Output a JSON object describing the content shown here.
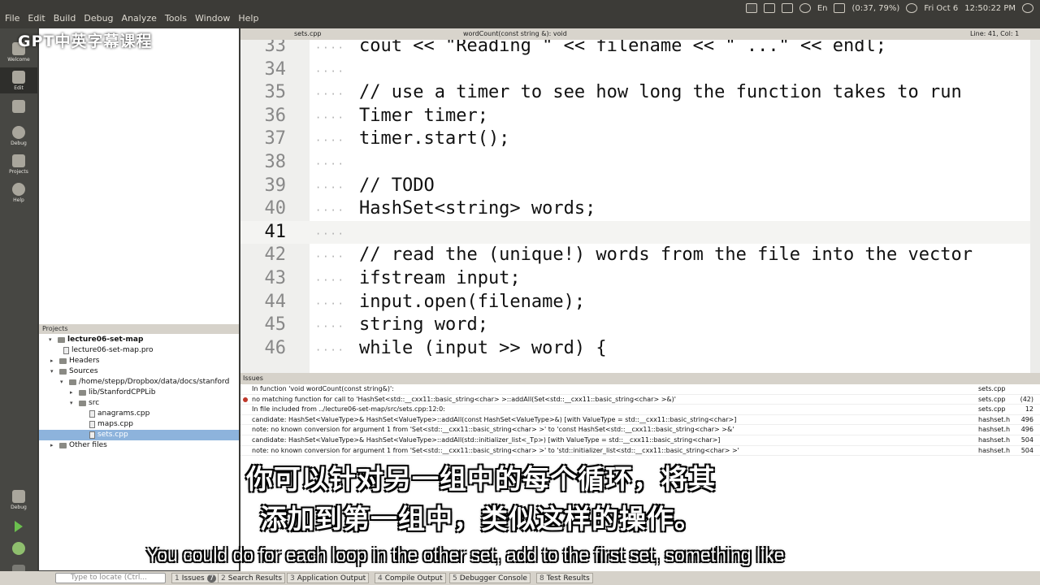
{
  "watermark": "GPT中英字幕课程",
  "menubar": {
    "items": [
      "File",
      "Edit",
      "Build",
      "Debug",
      "Analyze",
      "Tools",
      "Window",
      "Help"
    ],
    "tray": {
      "input_method": "En",
      "battery": "(0:37, 79%)",
      "datetime": "Fri Oct 6",
      "clock": "12:50:22 PM"
    }
  },
  "modebar": {
    "items": [
      {
        "label": "Welcome",
        "icon": "welcome-icon"
      },
      {
        "label": "Edit",
        "icon": "edit-icon"
      },
      {
        "label": "Design",
        "icon": "design-icon"
      },
      {
        "label": "Debug",
        "icon": "debug-icon"
      },
      {
        "label": "Projects",
        "icon": "projects-icon"
      },
      {
        "label": "Help",
        "icon": "help-icon"
      },
      {
        "label": "Debug",
        "icon": "debug-run-icon"
      }
    ]
  },
  "editor": {
    "file_tab": "sets.cpp",
    "function_combo": "wordCount(const string &): void",
    "position": "Line: 41, Col: 1",
    "lines": [
      {
        "num": "33",
        "code": "cout << \"Reading \" << filename << \" ...\" << endl;"
      },
      {
        "num": "34",
        "code": ""
      },
      {
        "num": "35",
        "code": "// use a timer to see how long the function takes to run"
      },
      {
        "num": "36",
        "code": "Timer timer;"
      },
      {
        "num": "37",
        "code": "timer.start();"
      },
      {
        "num": "38",
        "code": ""
      },
      {
        "num": "39",
        "code": "// TODO"
      },
      {
        "num": "40",
        "code": "HashSet<string> words;"
      },
      {
        "num": "41",
        "code": ""
      },
      {
        "num": "42",
        "code": "// read the (unique!) words from the file into the vector"
      },
      {
        "num": "43",
        "code": "ifstream input;"
      },
      {
        "num": "44",
        "code": "input.open(filename);"
      },
      {
        "num": "45",
        "code": "string word;"
      },
      {
        "num": "46",
        "code": "while (input >> word) {"
      }
    ]
  },
  "projects": {
    "header": "Projects",
    "tree": [
      {
        "label": "lecture06-set-map",
        "type": "project"
      },
      {
        "label": "lecture06-set-map.pro",
        "type": "file"
      },
      {
        "label": "Headers",
        "type": "folder"
      },
      {
        "label": "Sources",
        "type": "folder"
      },
      {
        "label": "/home/stepp/Dropbox/data/docs/stanford",
        "type": "folder"
      },
      {
        "label": "lib/StanfordCPPLib",
        "type": "folder"
      },
      {
        "label": "src",
        "type": "folder"
      },
      {
        "label": "anagrams.cpp",
        "type": "file"
      },
      {
        "label": "maps.cpp",
        "type": "file"
      },
      {
        "label": "sets.cpp",
        "type": "file"
      },
      {
        "label": "Other files",
        "type": "folder"
      }
    ]
  },
  "issues": {
    "header": "Issues",
    "rows": [
      {
        "msg": "In function 'void wordCount(const string&)':",
        "file": "sets.cpp",
        "line": ""
      },
      {
        "msg": "no matching function for call to 'HashSet<std::__cxx11::basic_string<char> >::addAll(Set<std::__cxx11::basic_string<char> >&)'",
        "file": "sets.cpp",
        "line": "(42)"
      },
      {
        "msg": "In file included from ../lecture06-set-map/src/sets.cpp:12:0:",
        "file": "sets.cpp",
        "line": "12"
      },
      {
        "msg": "candidate: HashSet<ValueType>& HashSet<ValueType>::addAll(const HashSet<ValueType>&) [with ValueType = std::__cxx11::basic_string<char>]",
        "file": "hashset.h",
        "line": "496"
      },
      {
        "msg": "note:   no known conversion for argument 1 from 'Set<std::__cxx11::basic_string<char> >' to 'const HashSet<std::__cxx11::basic_string<char> >&'",
        "file": "hashset.h",
        "line": "496"
      },
      {
        "msg": "candidate: HashSet<ValueType>& HashSet<ValueType>::addAll(std::initializer_list<_Tp>) [with ValueType = std::__cxx11::basic_string<char>]",
        "file": "hashset.h",
        "line": "504"
      },
      {
        "msg": "note:   no known conversion for argument 1 from 'Set<std::__cxx11::basic_string<char> >' to 'std::initializer_list<std::__cxx11::basic_string<char> >'",
        "file": "hashset.h",
        "line": "504"
      }
    ]
  },
  "bottombar": {
    "locate_placeholder": "Type to locate (Ctrl...",
    "tabs": [
      {
        "num": "1",
        "label": "Issues",
        "badge": "7"
      },
      {
        "num": "2",
        "label": "Search Results"
      },
      {
        "num": "3",
        "label": "Application Output"
      },
      {
        "num": "4",
        "label": "Compile Output"
      },
      {
        "num": "5",
        "label": "Debugger Console"
      },
      {
        "num": "8",
        "label": "Test Results"
      }
    ]
  },
  "subtitles": {
    "cn_line1": "你可以针对另一组中的每个循环，将其",
    "cn_line2": "添加到第一组中，类似这样的操作。",
    "en": "You could do for each loop in the other set, add to the first set, something like"
  }
}
